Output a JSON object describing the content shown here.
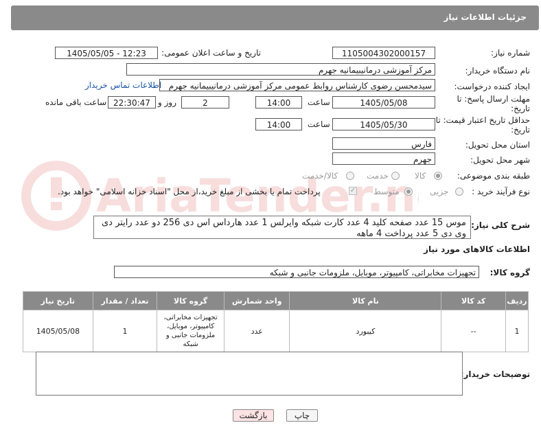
{
  "header": {
    "title": "جزئیات اطلاعات نیاز"
  },
  "form": {
    "need_number_label": "شماره نیاز:",
    "need_number": "1105004302000157",
    "announce_label": "تاریخ و ساعت اعلان عمومی:",
    "announce_value": "1405/05/05 - 12:23",
    "buyer_org_label": "نام دستگاه خریدار:",
    "buyer_org": "مرکز آموزشی درمانیبیمانیه جهرم",
    "creator_label": "ایجاد کننده درخواست:",
    "creator": "سیدمحسن رضوی کارشناس روابط عمومی مرکز آموزشی درمانیبیمانیه جهرم",
    "contact_link": "اطلاعات تماس خریدار",
    "deadline_label": "مهلت ارسال پاسخ: تا تاریخ:",
    "deadline_date": "1405/05/08",
    "time_label": "ساعت",
    "deadline_time": "14:00",
    "days_value": "2",
    "days_label": "روز و",
    "remaining_time": "22:30:47",
    "remaining_label": "ساعت باقی مانده",
    "price_validity_label": "حداقل تاریخ اعتبار قیمت: تا تاریخ:",
    "price_date": "1405/05/30",
    "price_time": "14:00",
    "province_label": "استان محل تحویل:",
    "province": "فارس",
    "city_label": "شهر محل تحویل:",
    "city": "جهرم",
    "category_label": "طبقه بندی موضوعی:",
    "category_options": [
      "کالا",
      "خدمت",
      "کالا/خدمت"
    ],
    "process_label": "نوع فرآیند خرید :",
    "process_options": [
      "جزیی",
      "متوسط"
    ],
    "payment_note": "پرداخت تمام یا بخشی از مبلغ خرید،از محل \"اسناد خزانه اسلامی\" خواهد بود.",
    "general_desc_label": "شرح کلی نیاز:",
    "general_desc": "موس 15 عدد صفحه کلید 4 عدد کارت شبکه وایرلس 1 عدد هارداس اس دی 256 دو عدد رایتر دی وی دی 5 عدد  پرداخت 4 ماهه",
    "goods_info_title": "اطلاعات کالاهای مورد نیاز",
    "goods_group_label": "گروه کالا:",
    "goods_group": "تجهیزات مخابراتی، کامپیوتر، موبایل، ملزومات جانبی و شبکه",
    "buyer_notes_label": "توضیحات خریدار:",
    "buyer_notes": ""
  },
  "table": {
    "headers": [
      "ردیف",
      "کد کالا",
      "نام کالا",
      "واحد شمارش",
      "گروه کالا",
      "تعداد / مقدار",
      "تاریخ نیاز"
    ],
    "rows": [
      [
        "1",
        "--",
        "کیبورد",
        "عدد",
        "تجهیزات مخابراتی، کامپیوتر، موبایل، ملزومات جانبی و شبکه",
        "1",
        "1405/05/08"
      ]
    ]
  },
  "buttons": {
    "print": "چاپ",
    "back": "بازگشت"
  },
  "watermark": {
    "text": "AriaTender.net"
  },
  "colors": {
    "header_bg": "#8a8a8a",
    "link": "#1a55a8",
    "back_btn": "#fde3e3",
    "print_btn": "#f5f5f5"
  }
}
